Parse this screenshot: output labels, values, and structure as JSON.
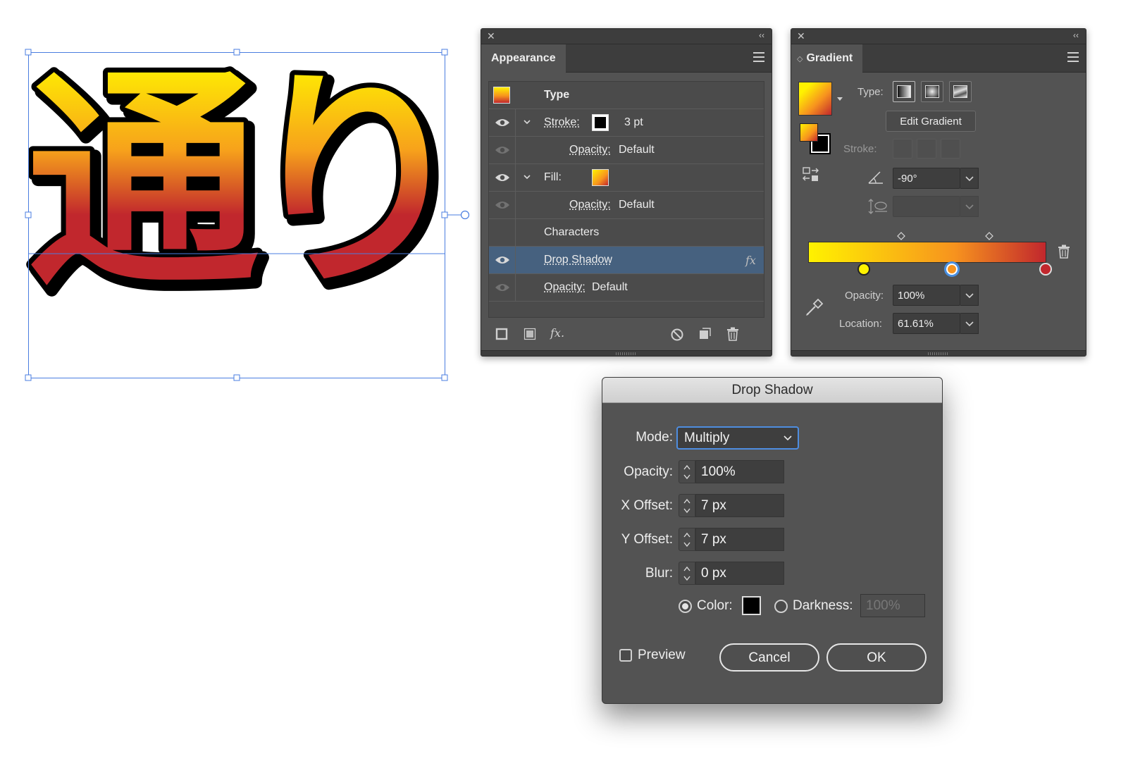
{
  "canvas": {
    "artwork_text": "通り",
    "gradient_colors": [
      "#fff200",
      "#f7a21b",
      "#c1272d"
    ]
  },
  "appearance": {
    "title": "Appearance",
    "header_label": "Type",
    "rows": [
      {
        "label": "Stroke:",
        "value": "3 pt"
      },
      {
        "label": "Opacity:",
        "value": "Default"
      },
      {
        "label": "Fill:",
        "value": ""
      },
      {
        "label": "Opacity:",
        "value": "Default"
      },
      {
        "label": "Characters",
        "value": ""
      },
      {
        "label": "Drop Shadow",
        "value": "fx"
      },
      {
        "label": "Opacity:",
        "value": "Default"
      }
    ],
    "footer_icons": [
      "new-stroke-icon",
      "new-fill-icon",
      "fx-icon",
      "clear-appearance-icon",
      "duplicate-item-icon",
      "delete-item-icon"
    ]
  },
  "gradient": {
    "title": "Gradient",
    "type_label": "Type:",
    "edit_button": "Edit Gradient",
    "stroke_label": "Stroke:",
    "angle": "-90°",
    "opacity_label": "Opacity:",
    "opacity_value": "100%",
    "location_label": "Location:",
    "location_value": "61.61%",
    "stops": [
      {
        "color": "#fff200",
        "location": 0
      },
      {
        "color": "#f7931e",
        "location": 61.61
      },
      {
        "color": "#c1272d",
        "location": 100
      }
    ]
  },
  "dialog": {
    "title": "Drop Shadow",
    "mode_label": "Mode:",
    "mode_value": "Multiply",
    "opacity_label": "Opacity:",
    "opacity_value": "100%",
    "x_label": "X Offset:",
    "x_value": "7 px",
    "y_label": "Y Offset:",
    "y_value": "7 px",
    "blur_label": "Blur:",
    "blur_value": "0 px",
    "color_label": "Color:",
    "darkness_label": "Darkness:",
    "darkness_value": "100%",
    "preview_label": "Preview",
    "cancel_label": "Cancel",
    "ok_label": "OK",
    "shadow_color": "#000000"
  }
}
